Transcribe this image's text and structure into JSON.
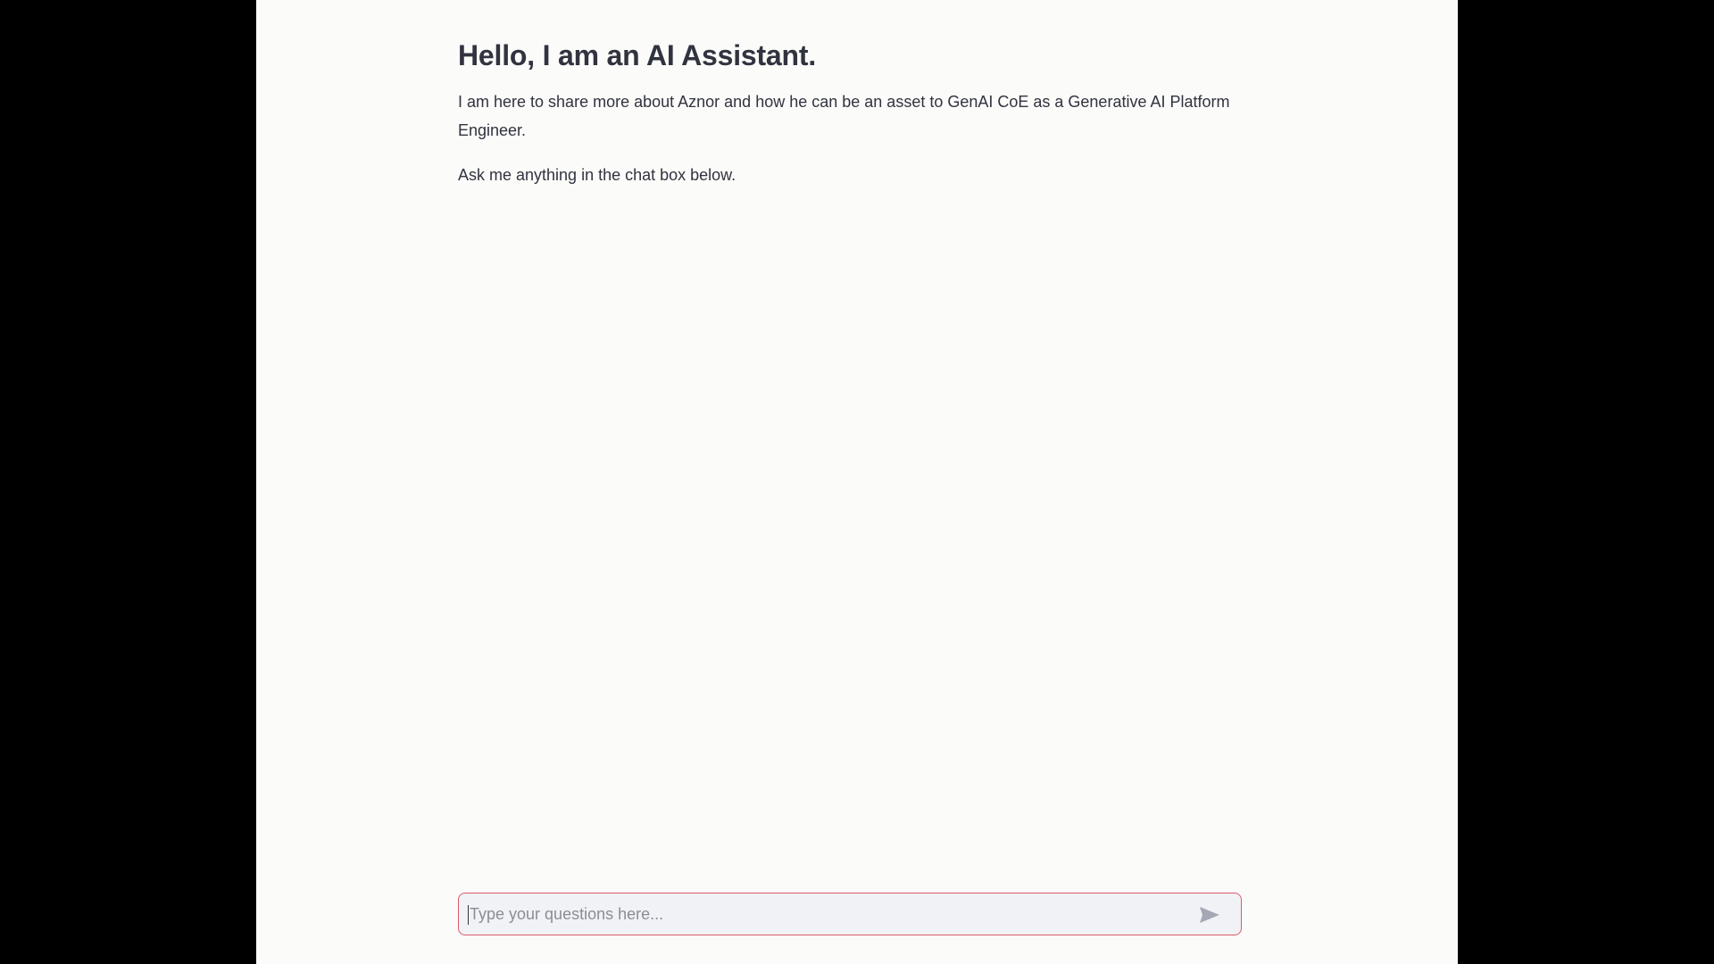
{
  "header": {
    "title": "Hello, I am an AI Assistant."
  },
  "main": {
    "paragraphs": [
      "I am here to share more about Aznor and how he can be an asset to GenAI CoE as a Generative AI Platform Engineer.",
      "Ask me anything in the chat box below."
    ]
  },
  "chat": {
    "placeholder": "Type your questions here...",
    "value": "",
    "send_icon": "send-icon"
  },
  "colors": {
    "page_background": "#fbfbf9",
    "letterbox": "#000000",
    "text": "#31333f",
    "input_focus_border": "#e0596a",
    "input_background": "#f0f2f6",
    "send_icon": "#a3a8b4"
  }
}
